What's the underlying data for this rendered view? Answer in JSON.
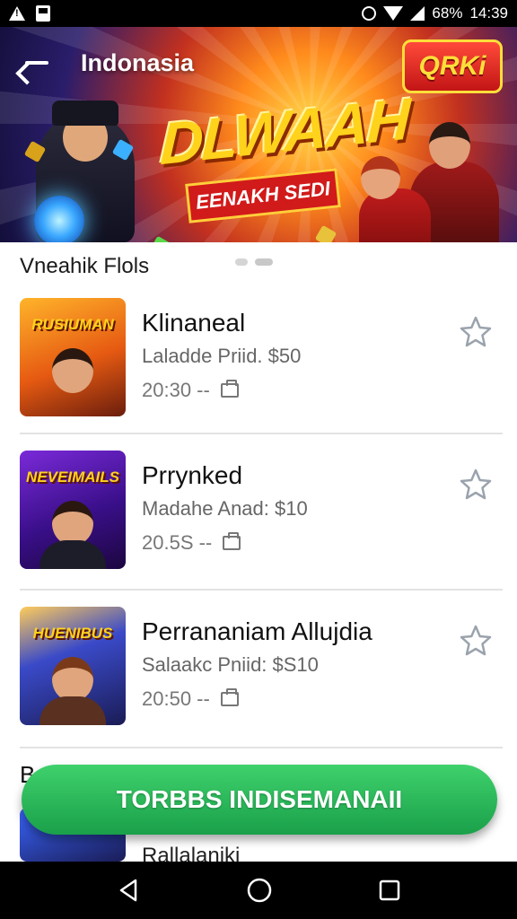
{
  "status_bar": {
    "battery": "68%",
    "time": "14:39"
  },
  "header": {
    "title": "Indonasia",
    "logo_text": "QRKi",
    "headline": "DLWAAH",
    "ribbon": "EENAKH SEDI"
  },
  "section": {
    "label": "Vneahik Flols"
  },
  "items": [
    {
      "title": "Klinaneal",
      "price": "Laladde Priid. $50",
      "meta": "20:30 --",
      "thumb_label": "RUSIUMAN"
    },
    {
      "title": "Prrynked",
      "price": "Madahe Anad: $10",
      "meta": "20.5S --",
      "thumb_label": "NEVEIMAILS"
    },
    {
      "title": "Perrananiam Allujdia",
      "price": "Salaakc Pniid: $S10",
      "meta": "20:50 --",
      "thumb_label": "HUENIBUS"
    }
  ],
  "peek": {
    "letter": "B",
    "title": "Rallalaniki"
  },
  "cta": {
    "label": "TORBBS INDISEMANAII"
  },
  "colors": {
    "cta": "#27b858",
    "star": "#9aa3ad"
  }
}
